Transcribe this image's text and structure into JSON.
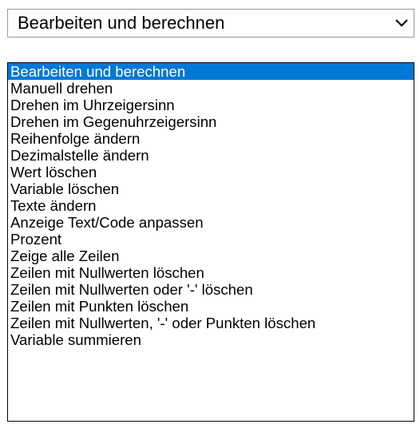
{
  "select": {
    "value": "Bearbeiten und berechnen",
    "arrow_icon": "chevron-down-icon"
  },
  "dropdown": {
    "selected_index": 0,
    "highlight_color": "#0078d7",
    "options": [
      "Bearbeiten und berechnen",
      "Manuell drehen",
      "Drehen im Uhrzeigersinn",
      "Drehen im Gegenuhrzeigersinn",
      "Reihenfolge ändern",
      "Dezimalstelle ändern",
      "Wert löschen",
      "Variable löschen",
      "Texte ändern",
      "Anzeige Text/Code anpassen",
      "Prozent",
      "Zeige alle Zeilen",
      "Zeilen mit Nullwerten löschen",
      "Zeilen mit Nullwerten oder '-' löschen",
      "Zeilen mit Punkten löschen",
      "Zeilen mit Nullwerten, '-' oder Punkten löschen",
      "Variable summieren"
    ]
  }
}
